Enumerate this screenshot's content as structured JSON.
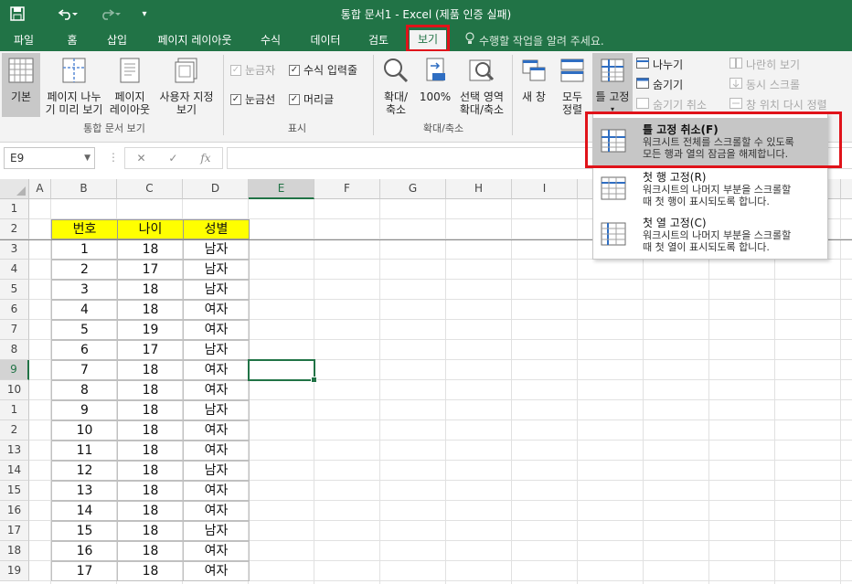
{
  "title": "통합 문서1 - Excel (제품 인증 실패)",
  "tabs": [
    "파일",
    "홈",
    "삽입",
    "페이지 레이아웃",
    "수식",
    "데이터",
    "검토",
    "보기"
  ],
  "tell_me": "수행할 작업을 알려 주세요.",
  "ribbon": {
    "workbook_views": {
      "normal": "기본",
      "page_break_1": "페이지 나누",
      "page_break_2": "기 미리 보기",
      "page_layout_1": "페이지",
      "page_layout_2": "레이아웃",
      "custom_1": "사용자 지정",
      "custom_2": "보기",
      "group": "통합 문서 보기"
    },
    "show": {
      "ruler": "눈금자",
      "formula_bar": "수식 입력줄",
      "gridlines": "눈금선",
      "headings": "머리글",
      "group": "표시"
    },
    "zoom": {
      "zoom_1": "확대/",
      "zoom_2": "축소",
      "zoom100": "100%",
      "zoom_sel_1": "선택 영역",
      "zoom_sel_2": "확대/축소",
      "group": "확대/축소"
    },
    "window": {
      "new_window": "새 창",
      "arrange_1": "모두",
      "arrange_2": "정렬",
      "freeze": "틀 고정",
      "split": "나누기",
      "hide": "숨기기",
      "unhide": "숨기기 취소",
      "side_by_side": "나란히 보기",
      "sync_scroll": "동시 스크롤",
      "reset_pos": "창 위치 다시 정렬"
    }
  },
  "namebox": "E9",
  "fx": "fx",
  "columns": [
    "A",
    "B",
    "C",
    "D",
    "E",
    "F",
    "G",
    "H",
    "I"
  ],
  "selected_col": "E",
  "selected_row": "9",
  "row_numbers": [
    "1",
    "2",
    "3",
    "4",
    "5",
    "6",
    "7",
    "8",
    "9",
    "10",
    "1",
    "2",
    "13",
    "14",
    "15",
    "16",
    "17",
    "18",
    "19"
  ],
  "table": {
    "headers": [
      "번호",
      "나이",
      "성별"
    ],
    "rows": [
      [
        "1",
        "18",
        "남자"
      ],
      [
        "2",
        "17",
        "남자"
      ],
      [
        "3",
        "18",
        "남자"
      ],
      [
        "4",
        "18",
        "여자"
      ],
      [
        "5",
        "19",
        "여자"
      ],
      [
        "6",
        "17",
        "남자"
      ],
      [
        "7",
        "18",
        "여자"
      ],
      [
        "8",
        "18",
        "여자"
      ],
      [
        "9",
        "18",
        "남자"
      ],
      [
        "10",
        "18",
        "여자"
      ],
      [
        "11",
        "18",
        "여자"
      ],
      [
        "12",
        "18",
        "남자"
      ],
      [
        "13",
        "18",
        "여자"
      ],
      [
        "14",
        "18",
        "여자"
      ],
      [
        "15",
        "18",
        "남자"
      ],
      [
        "16",
        "18",
        "여자"
      ],
      [
        "17",
        "18",
        "여자"
      ]
    ]
  },
  "freeze_menu": {
    "items": [
      {
        "title": "틀 고정 취소(F)",
        "desc1": "워크시트 전체를 스크롤할 수 있도록",
        "desc2": "모든 행과 열의 잠금을 해제합니다."
      },
      {
        "title": "첫 행 고정(R)",
        "desc1": "워크시트의 나머지 부분을 스크롤할",
        "desc2": "때 첫 행이 표시되도록 합니다."
      },
      {
        "title": "첫 열 고정(C)",
        "desc1": "워크시트의 나머지 부분을 스크롤할",
        "desc2": "때 첫 열이 표시되도록 합니다."
      }
    ]
  },
  "colors": {
    "brand": "#217346",
    "highlight": "#e0131a",
    "header_fill": "#ffff00"
  }
}
